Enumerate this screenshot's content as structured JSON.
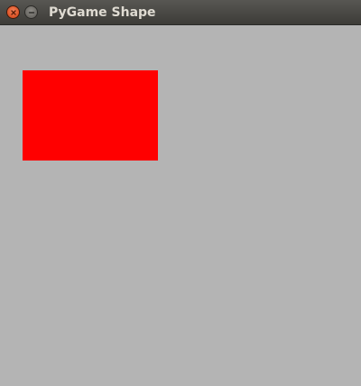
{
  "window": {
    "title": "PyGame Shape",
    "buttons": {
      "close": {
        "icon": "close-icon"
      },
      "minimize": {
        "icon": "minimize-icon"
      }
    }
  },
  "canvas": {
    "background_color": "#b4b4b4",
    "shapes": [
      {
        "type": "rectangle",
        "color": "#ff0000"
      }
    ]
  }
}
